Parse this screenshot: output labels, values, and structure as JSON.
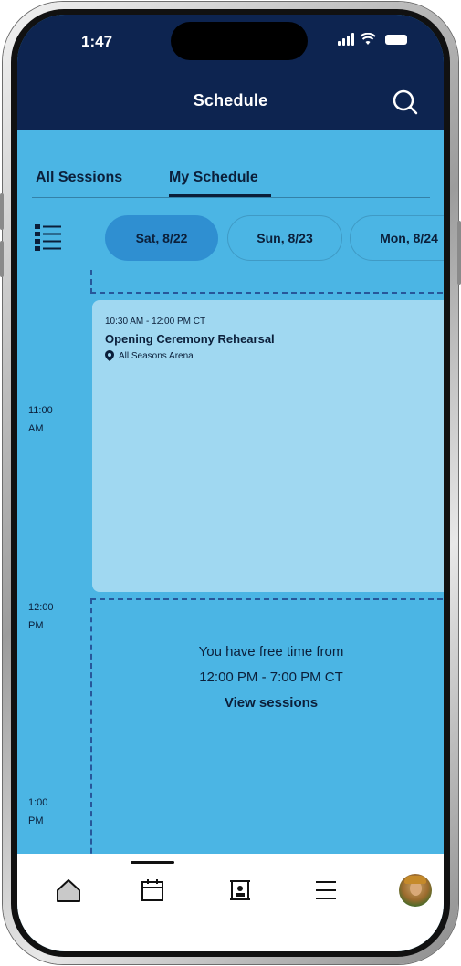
{
  "status_bar": {
    "time": "1:47"
  },
  "header": {
    "title": "Schedule",
    "search_icon": "search-icon",
    "background": "#0d2450"
  },
  "tabs": [
    {
      "label": "All Sessions",
      "active": false
    },
    {
      "label": "My Schedule",
      "active": true
    }
  ],
  "date_selector": {
    "view_toggle_icon": "list-view-icon",
    "dates": [
      {
        "label": "Sat, 8/22",
        "selected": true
      },
      {
        "label": "Sun, 8/23",
        "selected": false
      },
      {
        "label": "Mon, 8/24",
        "selected": false
      }
    ]
  },
  "timeline": {
    "time_labels": [
      {
        "hour": "11:00",
        "period": "AM"
      },
      {
        "hour": "12:00",
        "period": "PM"
      },
      {
        "hour": "1:00",
        "period": "PM"
      }
    ],
    "event": {
      "time": "10:30 AM - 12:00 PM CT",
      "title": "Opening Ceremony Rehearsal",
      "location": "All Seasons Arena",
      "location_icon": "map-pin-icon"
    },
    "free_time": {
      "line1": "You have free time from",
      "line2": "12:00 PM - 7:00 PM CT",
      "link": "View sessions"
    }
  },
  "bottom_nav": {
    "items": [
      "home-icon",
      "calendar-icon",
      "badge-icon",
      "menu-icon",
      "profile-avatar"
    ],
    "active": "calendar-icon"
  },
  "colors": {
    "page_background": "#4bb5e4",
    "selected_date": "#2f8fd1",
    "event_card": "#a0d8f1",
    "text_dark": "#0b1f3a"
  }
}
